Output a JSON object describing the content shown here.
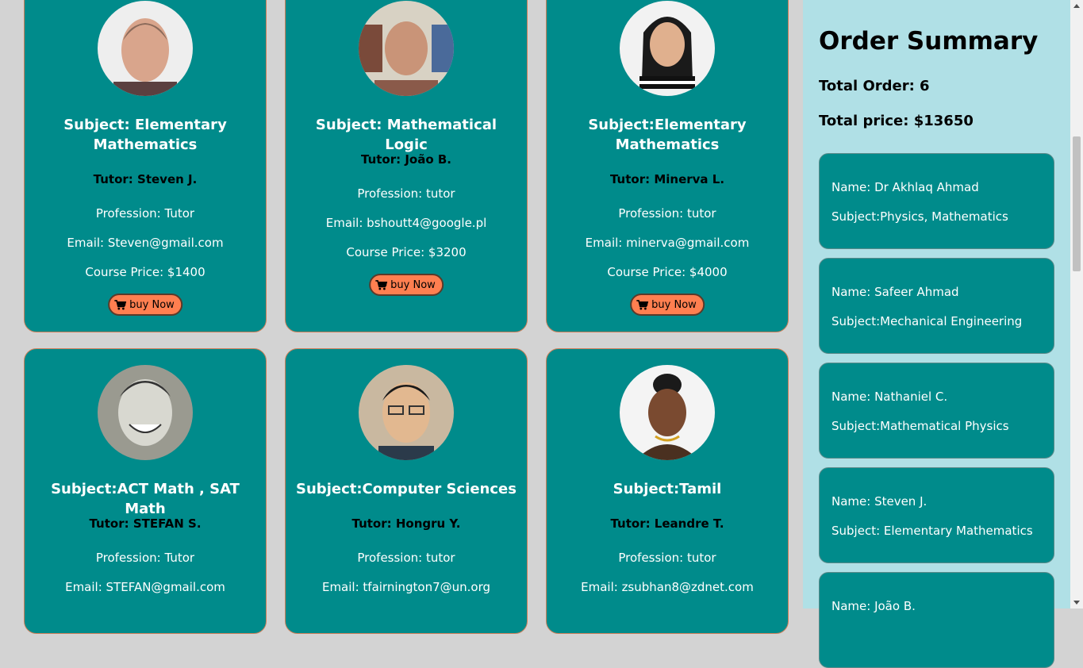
{
  "tutors": [
    {
      "subject": "Subject: Elementary Mathematics",
      "tutor": "Tutor: Steven J.",
      "profession": "Profession: Tutor",
      "email": "Email: Steven@gmail.com",
      "price": "Course Price: $1400",
      "button": "buy Now"
    },
    {
      "subject": "Subject: Mathematical Logic",
      "tutor": "Tutor: João B.",
      "profession": "Profession: tutor",
      "email": "Email: bshoutt4@google.pl",
      "price": "Course Price: $3200",
      "button": "buy Now"
    },
    {
      "subject": "Subject:Elementary Mathematics",
      "tutor": "Tutor: Minerva L.",
      "profession": "Profession: tutor",
      "email": "Email: minerva@gmail.com",
      "price": "Course Price: $4000",
      "button": "buy Now"
    },
    {
      "subject": "Subject:ACT Math , SAT Math",
      "tutor": "Tutor: STEFAN S.",
      "profession": "Profession: Tutor",
      "email": "Email: STEFAN@gmail.com"
    },
    {
      "subject": "Subject:Computer Sciences",
      "tutor": "Tutor: Hongru Y.",
      "profession": "Profession: tutor",
      "email": "Email: tfairnington7@un.org"
    },
    {
      "subject": "Subject:Tamil",
      "tutor": "Tutor: Leandre T.",
      "profession": "Profession: tutor",
      "email": "Email: zsubhan8@zdnet.com"
    }
  ],
  "summary": {
    "title": "Order Summary",
    "total_order": "Total Order: 6",
    "total_price": "Total price: $13650",
    "orders": [
      {
        "name": "Name: Dr Akhlaq Ahmad",
        "subject": "Subject:Physics, Mathematics"
      },
      {
        "name": "Name: Safeer Ahmad",
        "subject": "Subject:Mechanical Engineering"
      },
      {
        "name": "Name: Nathaniel C.",
        "subject": "Subject:Mathematical Physics"
      },
      {
        "name": "Name: Steven J.",
        "subject": "Subject: Elementary Mathematics"
      },
      {
        "name": "Name: João B.",
        "subject": ""
      }
    ]
  },
  "colors": {
    "card": "#008b8b",
    "button": "#ff7f50",
    "sidebar": "#b0e0e6",
    "page": "#d3d3d3"
  },
  "icons": {
    "buy_button": "shopping-cart-icon"
  }
}
